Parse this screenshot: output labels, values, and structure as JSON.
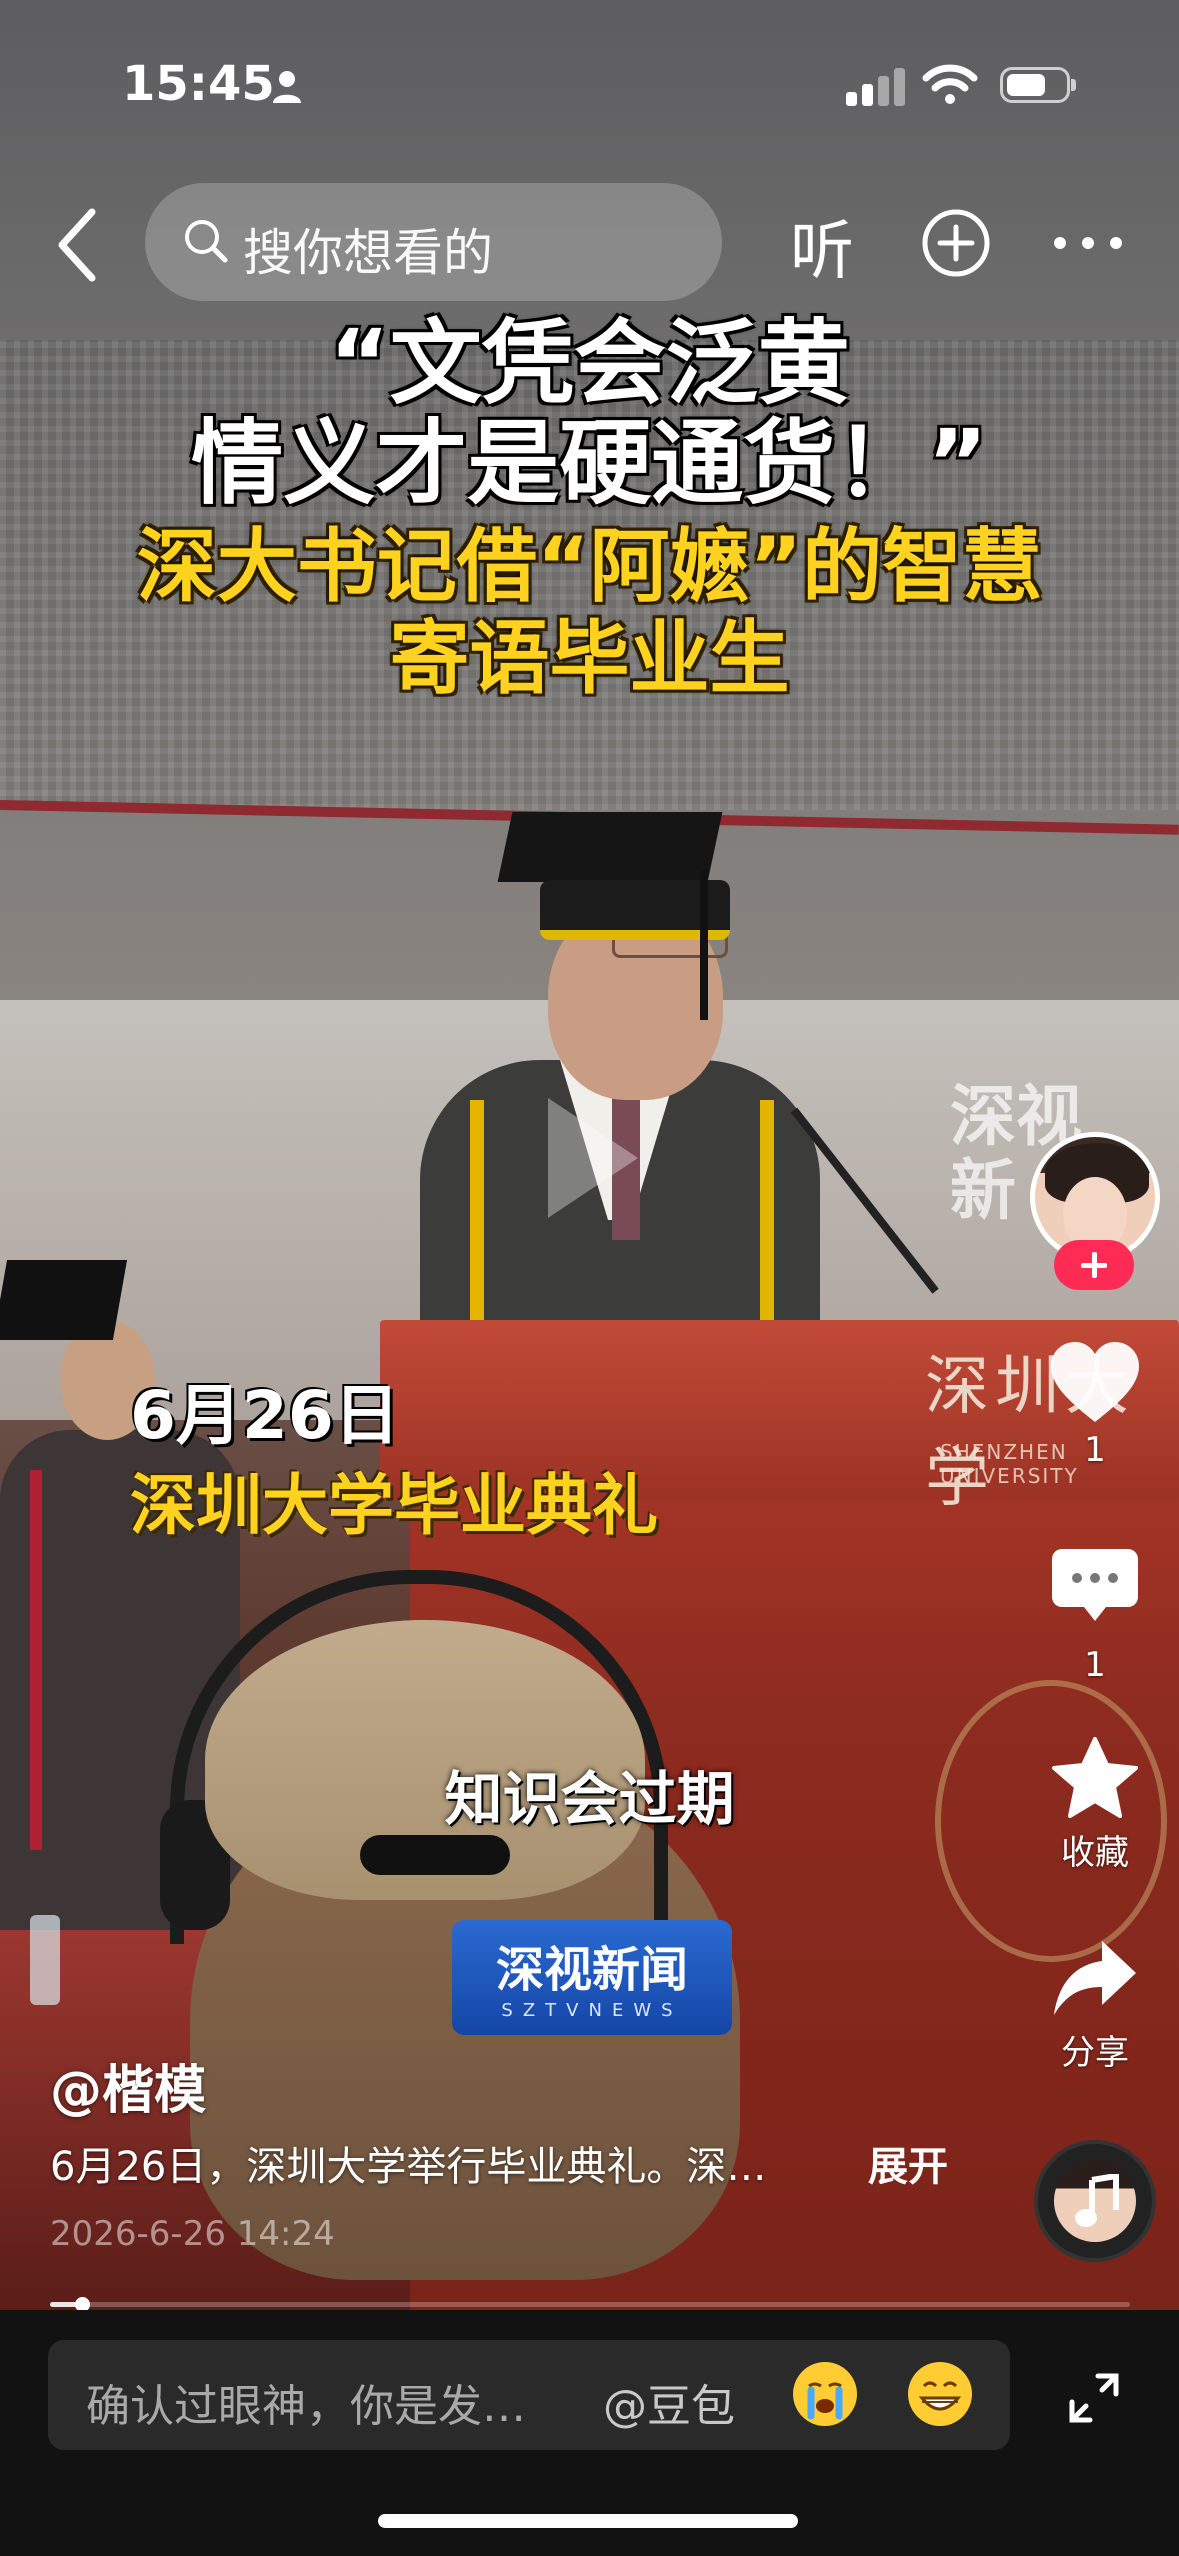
{
  "status_bar": {
    "time": "15:45"
  },
  "top_nav": {
    "search_placeholder": "搜你想看的",
    "listen_label": "听"
  },
  "video": {
    "headline_line1": "“文凭会泛黄",
    "headline_line2": "情义才是硬通货！”",
    "headline_line3": "深大书记借“阿嬷”的智慧",
    "headline_line4": "寄语毕业生",
    "date_caption": "6月26日",
    "event_caption": "深圳大学毕业典礼",
    "subtitle": "知识会过期",
    "watermark_line1": "深视",
    "watermark_line2": "新",
    "news_badge_title": "深视新闻",
    "news_badge_sub": "SZTVNEWS",
    "podium_text": "深圳大学",
    "podium_sub": "SHENZHEN UNIVERSITY",
    "progress_fraction": 0.03
  },
  "right_rail": {
    "like_count": "1",
    "comment_count": "1",
    "favorite_label": "收藏",
    "share_label": "分享"
  },
  "post": {
    "author": "@楷模",
    "description": "6月26日，深圳大学举行毕业典礼。深…",
    "expand_label": "展开",
    "post_time": "2026-6-26 14:24"
  },
  "comment_bar": {
    "placeholder": "确认过眼神，你是发…",
    "mention": "@豆包"
  },
  "colors": {
    "follow_red": "#fe2c55",
    "caption_yellow": "#ffd21f",
    "badge_blue": "#1f57c0"
  }
}
